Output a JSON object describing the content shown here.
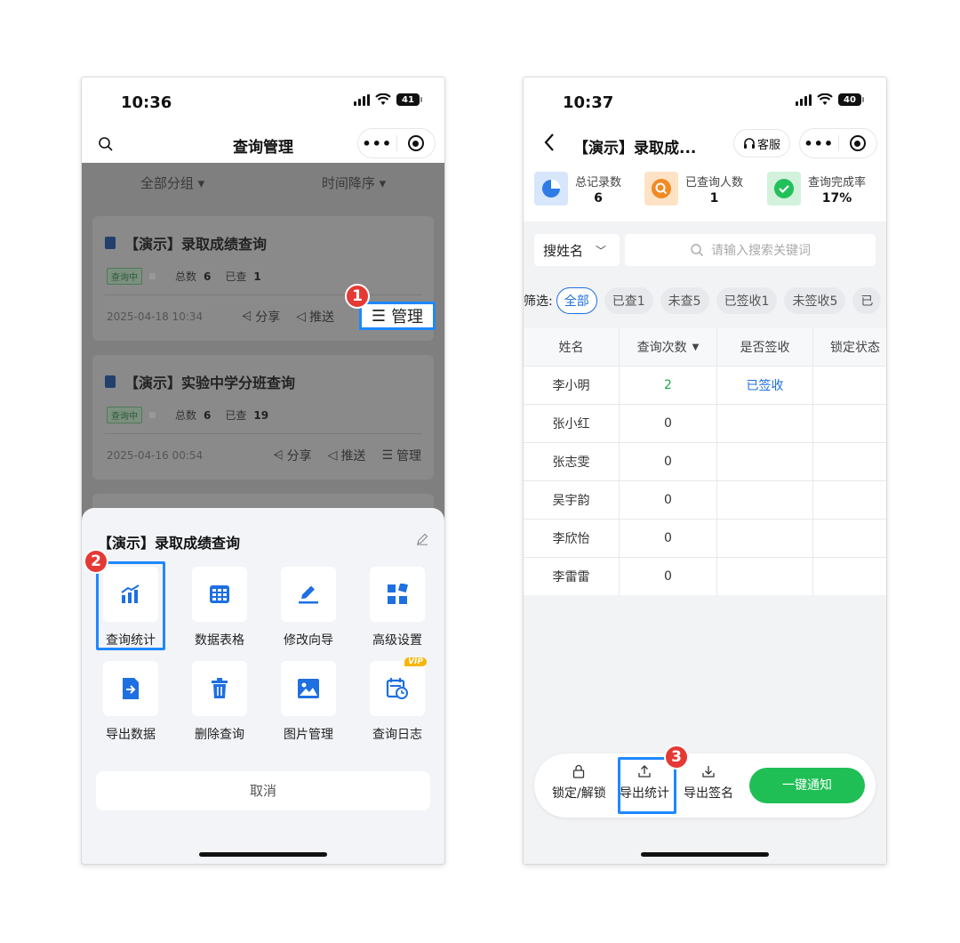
{
  "left": {
    "status": {
      "time": "10:36",
      "battery": "41"
    },
    "nav": {
      "title": "查询管理"
    },
    "sort": {
      "group": "全部分组",
      "order": "时间降序"
    },
    "cards": [
      {
        "title": "【演示】录取成绩查询",
        "badge": "查询中",
        "total_label": "总数",
        "total": "6",
        "viewed_label": "已查",
        "viewed": "1",
        "date": "2025-04-18 10:34",
        "share": "分享",
        "push": "推送",
        "manage": "管理"
      },
      {
        "title": "【演示】实验中学分班查询",
        "badge": "查询中",
        "total_label": "总数",
        "total": "6",
        "viewed_label": "已查",
        "viewed": "19",
        "date": "2025-04-16 00:54",
        "share": "分享",
        "push": "推送",
        "manage": "管理"
      }
    ],
    "steps": [
      "1",
      "2"
    ],
    "sheet": {
      "title": "【演示】录取成绩查询",
      "items": [
        "查询统计",
        "数据表格",
        "修改向导",
        "高级设置",
        "导出数据",
        "删除查询",
        "图片管理",
        "查询日志"
      ],
      "vip": "VIP",
      "cancel": "取消"
    }
  },
  "right": {
    "status": {
      "time": "10:37",
      "battery": "40"
    },
    "nav": {
      "title": "【演示】录取成...",
      "service": "客服"
    },
    "stats": [
      {
        "label": "总记录数",
        "value": "6",
        "color": "#2f7be6"
      },
      {
        "label": "已查询人数",
        "value": "1",
        "color": "#f08a24"
      },
      {
        "label": "查询完成率",
        "value": "17%",
        "color": "#22c05a"
      }
    ],
    "search": {
      "field": "搜姓名",
      "placeholder": "请输入搜索关键词"
    },
    "filter": {
      "label": "筛选:",
      "chips": [
        "全部",
        "已查1",
        "未查5",
        "已签收1",
        "未签收5",
        "已"
      ]
    },
    "table": {
      "headers": [
        "姓名",
        "查询次数",
        "是否签收",
        "锁定状态"
      ],
      "rows": [
        {
          "name": "李小明",
          "count": "2",
          "signed": "已签收"
        },
        {
          "name": "张小红",
          "count": "0",
          "signed": ""
        },
        {
          "name": "张志雯",
          "count": "0",
          "signed": ""
        },
        {
          "name": "吴宇韵",
          "count": "0",
          "signed": ""
        },
        {
          "name": "李欣怡",
          "count": "0",
          "signed": ""
        },
        {
          "name": "李雷雷",
          "count": "0",
          "signed": ""
        }
      ]
    },
    "bottom": {
      "lock": "锁定/解锁",
      "export_stats": "导出统计",
      "export_sign": "导出签名",
      "notify": "一键通知"
    },
    "step": "3"
  }
}
